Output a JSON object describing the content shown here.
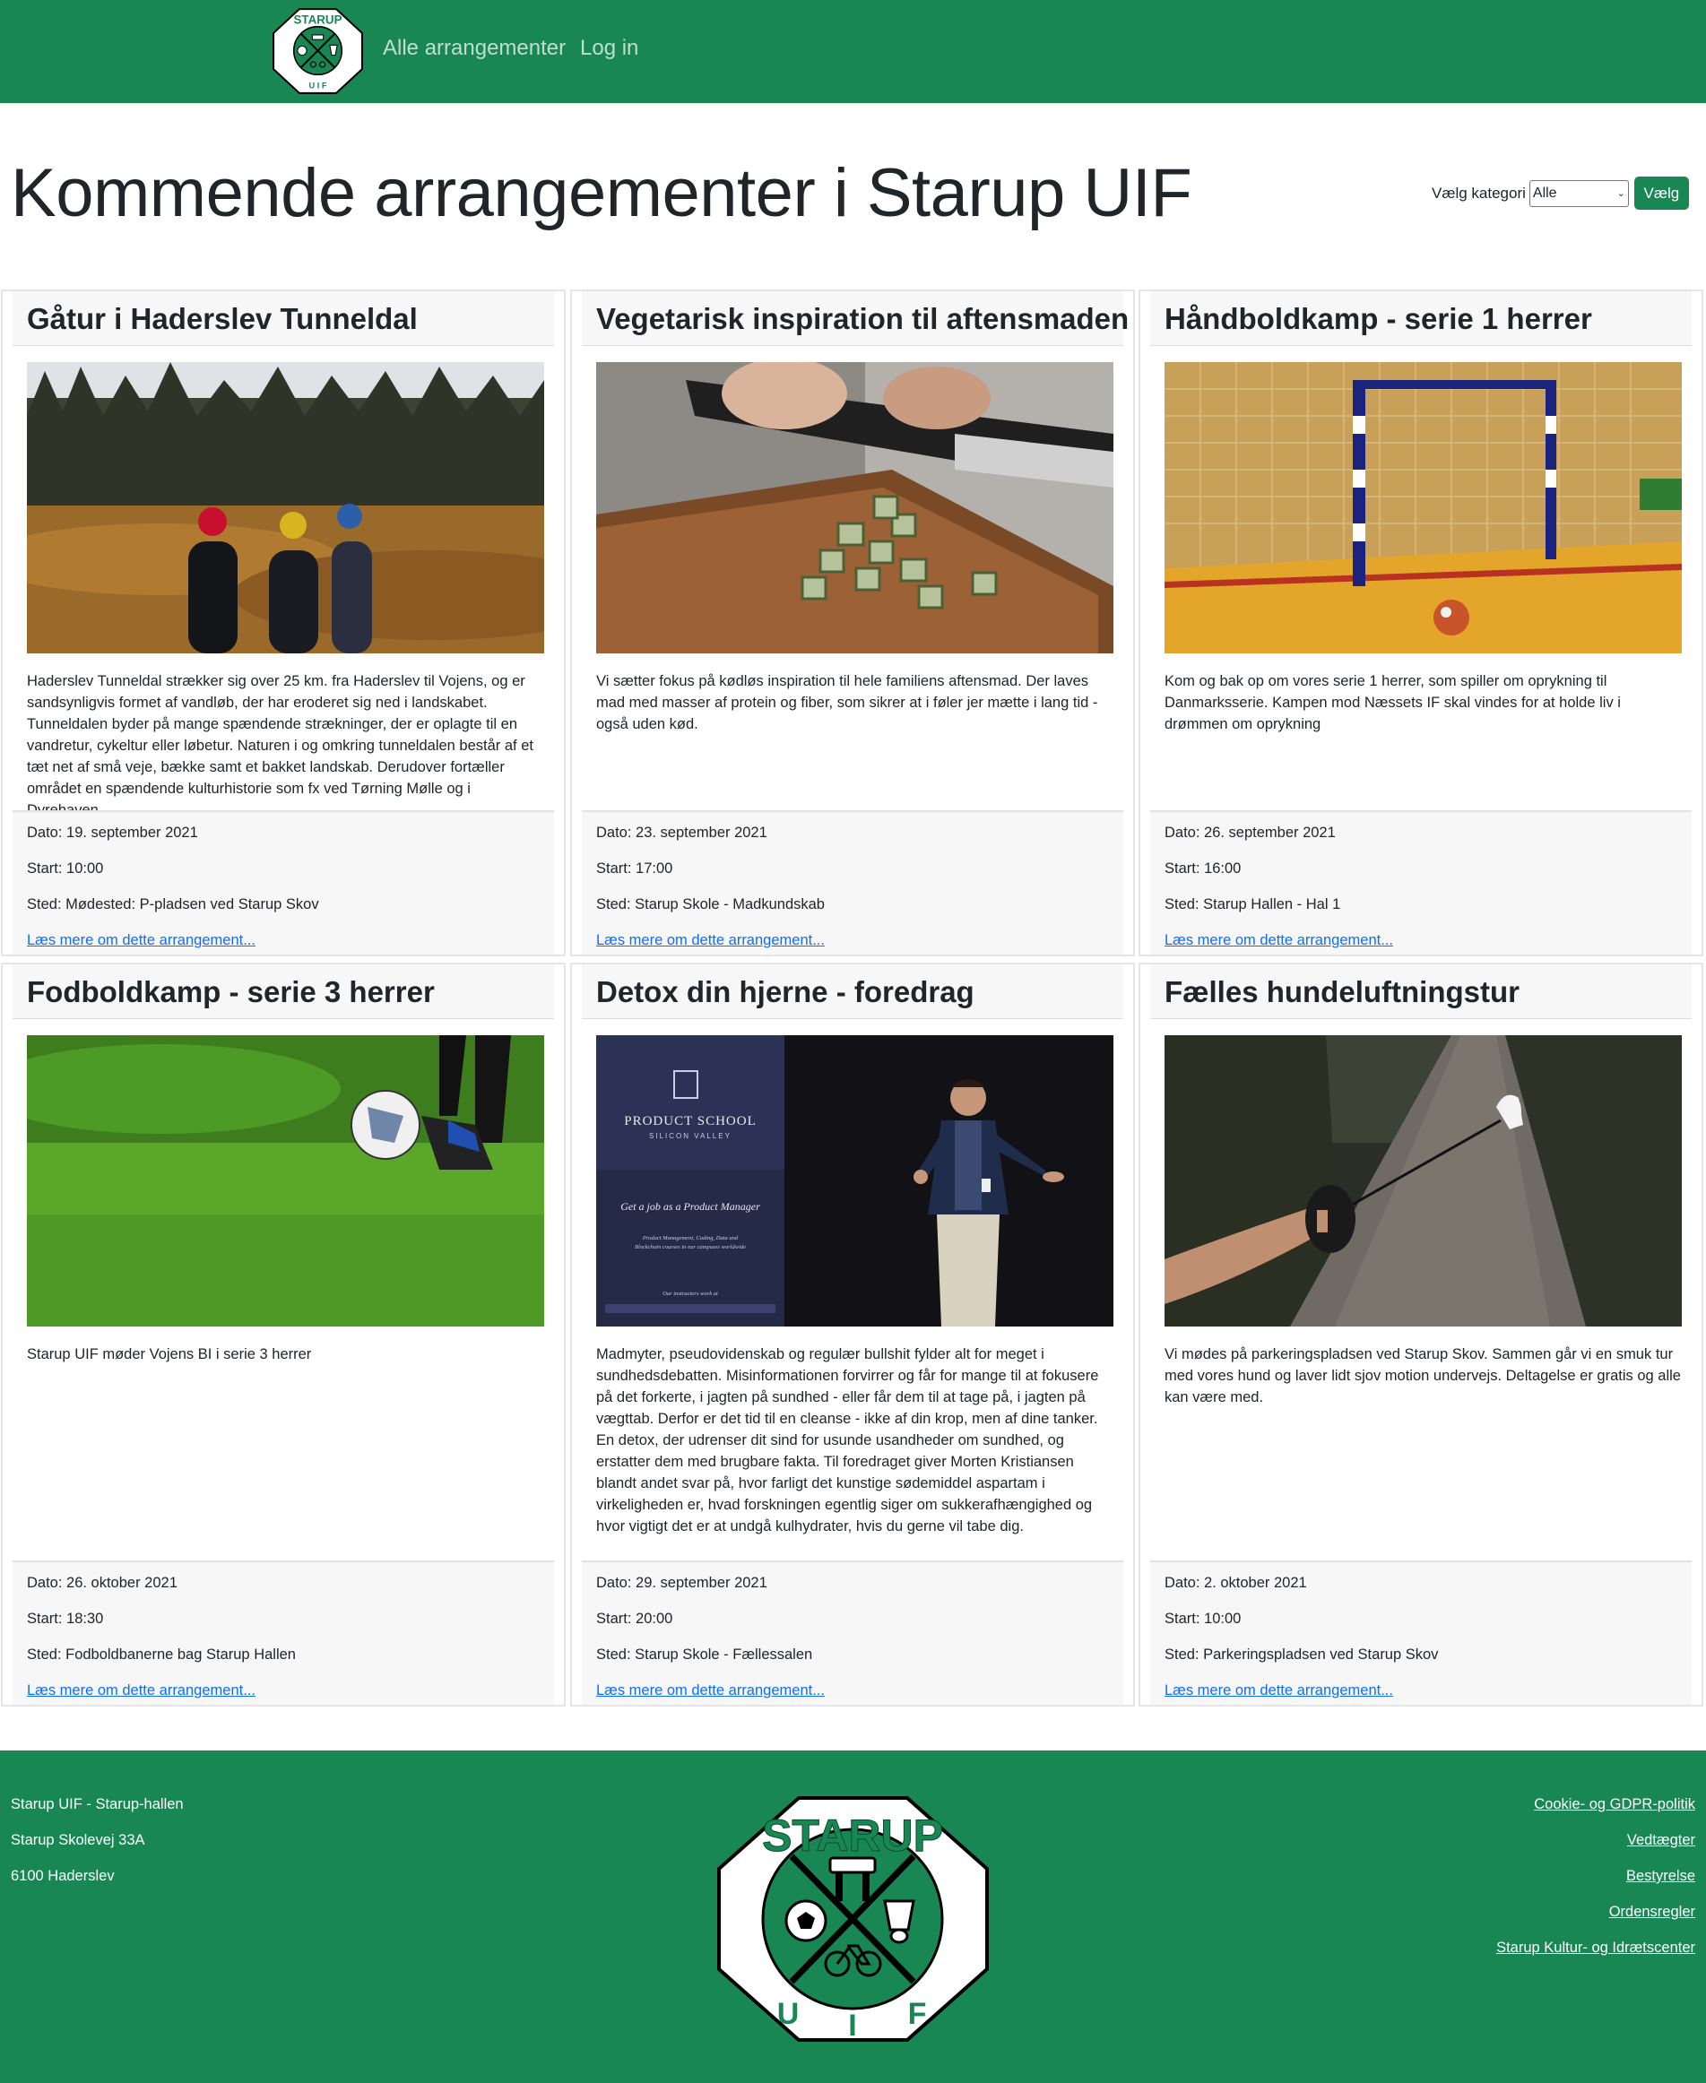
{
  "nav": {
    "logo_top": "STARUP",
    "logo_bottom": "U I F",
    "links": [
      "Alle arrangementer",
      "Log in"
    ]
  },
  "header": {
    "title": "Kommende arrangementer i Starup UIF",
    "filter_label": "Vælg kategori",
    "filter_value": "Alle",
    "filter_button": "Vælg"
  },
  "events": [
    {
      "title": "Gåtur i Haderslev Tunneldal",
      "text": "Haderslev Tunneldal strækker sig over 25 km. fra Haderslev til Vojens, og er sandsynligvis formet af vandløb, der har eroderet sig ned i landskabet. Tunneldalen byder på mange spændende strækninger, der er oplagte til en vandretur, cykeltur eller løbetur. Naturen i og omkring tunneldalen består af et tæt net af små veje, bække samt et bakket landskab. Derudover fortæller området en spændende kulturhistorie som fx ved Tørning Mølle og i Dyrehaven.",
      "date": "Dato: 19. september 2021",
      "start": "Start: 10:00",
      "place": "Sted: Mødested: P-pladsen ved Starup Skov",
      "more": "Læs mere om dette arrangement..."
    },
    {
      "title": "Vegetarisk inspiration til aftensmaden",
      "text": "Vi sætter fokus på kødløs inspiration til hele familiens aftensmad. Der laves mad med masser af protein og fiber, som sikrer at i føler jer mætte i lang tid - også uden kød.",
      "date": "Dato: 23. september 2021",
      "start": "Start: 17:00",
      "place": "Sted: Starup Skole - Madkundskab",
      "more": "Læs mere om dette arrangement..."
    },
    {
      "title": "Håndboldkamp - serie 1 herrer",
      "text": "Kom og bak op om vores serie 1 herrer, som spiller om oprykning til Danmarksserie. Kampen mod Næssets IF skal vindes for at holde liv i drømmen om oprykning",
      "date": "Dato: 26. september 2021",
      "start": "Start: 16:00",
      "place": "Sted: Starup Hallen - Hal 1",
      "more": "Læs mere om dette arrangement..."
    },
    {
      "title": "Fodboldkamp - serie 3 herrer",
      "text": "Starup UIF møder Vojens BI i serie 3 herrer",
      "date": "Dato: 26. oktober 2021",
      "start": "Start: 18:30",
      "place": "Sted: Fodboldbanerne bag Starup Hallen",
      "more": "Læs mere om dette arrangement..."
    },
    {
      "title": "Detox din hjerne - foredrag",
      "text": "Madmyter, pseudovidenskab og regulær bullshit fylder alt for meget i sundhedsdebatten. Misinformationen forvirrer og får for mange til at fokusere på det forkerte, i jagten på sundhed - eller får dem til at tage på, i jagten på vægttab. Derfor er det tid til en cleanse - ikke af din krop, men af dine tanker. En detox, der udrenser dit sind for usunde usandheder om sundhed, og erstatter dem med brugbare fakta. Til foredraget giver Morten Kristiansen blandt andet svar på, hvor farligt det kunstige sødemiddel aspartam i virkeligheden er, hvad forskningen egentlig siger om sukkerafhængighed og hvor vigtigt det er at undgå kulhydrater, hvis du gerne vil tabe dig.",
      "date": "Dato: 29. september 2021",
      "start": "Start: 20:00",
      "place": "Sted: Starup Skole - Fællessalen",
      "more": "Læs mere om dette arrangement...",
      "banner": {
        "line1": "PRODUCT SCHOOL",
        "line2": "SILICON VALLEY",
        "line3": "Get a job as a Product Manager",
        "line4": "Product Management, Coding, Data and",
        "line5": "Blockchain courses in our campuses worldwide",
        "line6": "Our instructors work at"
      }
    },
    {
      "title": "Fælles hundeluftningstur",
      "text": "Vi mødes på parkeringspladsen ved Starup Skov. Sammen går vi en smuk tur med vores hund og laver lidt sjov motion undervejs. Deltagelse er gratis og alle kan være med.",
      "date": "Dato: 2. oktober 2021",
      "start": "Start: 10:00",
      "place": "Sted: Parkeringspladsen ved Starup Skov",
      "more": "Læs mere om dette arrangement..."
    }
  ],
  "footer": {
    "address": [
      "Starup UIF - Starup-hallen",
      "Starup Skolevej 33A",
      "6100 Haderslev"
    ],
    "links": [
      "Cookie- og GDPR-politik",
      "Vedtægter",
      "Bestyrelse",
      "Ordensregler",
      "Starup Kultur- og Idrætscenter"
    ],
    "logo_top": "STARUP",
    "logo_bottom": [
      "U",
      "I",
      "F"
    ]
  },
  "colors": {
    "brand": "#198754",
    "link": "#0d6efd"
  },
  "icons": [
    "club-logo",
    "select-chevron-icon"
  ]
}
